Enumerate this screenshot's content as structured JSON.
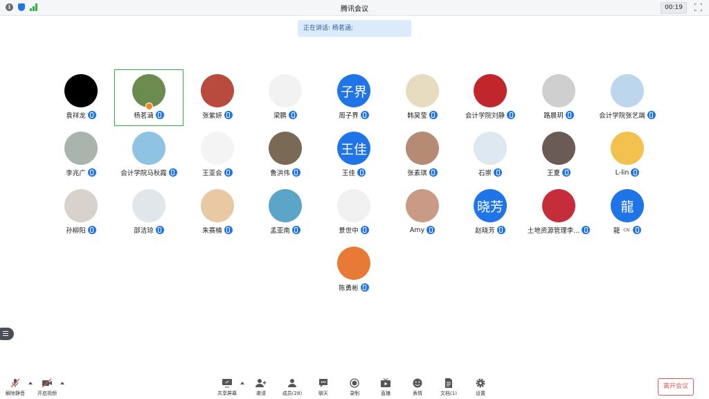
{
  "window": {
    "title": "腾讯会议",
    "timer": "00:19"
  },
  "speaking_banner": "正在讲话: 杨茗涵;",
  "participants": [
    {
      "name": "袁祥龙",
      "avatar": "black-circle-avatar",
      "color": "#000000"
    },
    {
      "name": "杨茗涵",
      "avatar": "girl-with-plants-avatar",
      "color": "#6c8b4e",
      "active": true,
      "host": true
    },
    {
      "name": "张紫妍",
      "avatar": "child-photo-avatar",
      "color": "#b94a3e"
    },
    {
      "name": "梁鹏",
      "avatar": "popeye-cartoon-avatar",
      "color": "#f2f2f2"
    },
    {
      "name": "周子界",
      "avatar_text": "子界",
      "color": "#1f75e8"
    },
    {
      "name": "韩昊莹",
      "avatar": "calligraphy-avatar",
      "color": "#e8dcc0"
    },
    {
      "name": "会计学院刘静",
      "avatar": "red-cartoon-avatar",
      "color": "#c0262b"
    },
    {
      "name": "路晨玥",
      "avatar": "cat-photo-avatar",
      "color": "#cfcfcf"
    },
    {
      "name": "会计学院张艺端",
      "avatar": "doraemon-avatar",
      "color": "#bcd6ee"
    },
    {
      "name": "李兆广",
      "avatar": "misty-mountain-avatar",
      "color": "#a9b4ad"
    },
    {
      "name": "会计学院马秋霞",
      "avatar": "sky-girl-avatar",
      "color": "#8ec3e3"
    },
    {
      "name": "王亚会",
      "avatar": "cartoon-cat-avatar",
      "color": "#f4f4f4"
    },
    {
      "name": "鲁洪伟",
      "avatar": "elder-photo-avatar",
      "color": "#7a6a55"
    },
    {
      "name": "王佳",
      "avatar_text": "王佳",
      "color": "#1f75e8"
    },
    {
      "name": "张素琪",
      "avatar": "portrait-photo-avatar",
      "color": "#b58b74"
    },
    {
      "name": "石崇",
      "avatar": "cartoon-boy-avatar",
      "color": "#dde8f0"
    },
    {
      "name": "王夏",
      "avatar": "long-hair-photo-avatar",
      "color": "#6b5b55"
    },
    {
      "name": "L-lin",
      "avatar": "teddy-bear-avatar",
      "color": "#f2c14e"
    },
    {
      "name": "孙柳阳",
      "avatar": "woman-photo-avatar",
      "color": "#d9d2cc"
    },
    {
      "name": "邵洁琼",
      "avatar": "figure-sketch-avatar",
      "color": "#e1e6ea"
    },
    {
      "name": "朱赛楠",
      "avatar": "princess-cartoon-avatar",
      "color": "#e9c9a3"
    },
    {
      "name": "孟亚南",
      "avatar": "beach-photo-avatar",
      "color": "#5aa5c8"
    },
    {
      "name": "景世中",
      "avatar": "glasses-cartoon-avatar",
      "color": "#f0f0f0"
    },
    {
      "name": "Amy",
      "avatar": "glasses-woman-avatar",
      "color": "#c99a86"
    },
    {
      "name": "赵晓芳",
      "avatar_text": "晓芳",
      "color": "#1f75e8"
    },
    {
      "name": "土地资源管理李...",
      "avatar": "sailor-moon-avatar",
      "color": "#c62d3a"
    },
    {
      "name": "龍",
      "avatar_text": "龍",
      "color": "#1f75e8",
      "tag": "CN"
    },
    {
      "name": "陈勇彬",
      "avatar": "goku-cartoon-avatar",
      "color": "#e87a36"
    }
  ],
  "toolbar": {
    "unmute": "解除静音",
    "start_video": "开启视频",
    "share_screen": "共享屏幕",
    "invite": "邀请",
    "members": "成员(28)",
    "chat": "聊天",
    "record": "录制",
    "live": "直播",
    "reactions": "表情",
    "docs": "文档(1)",
    "settings": "设置",
    "leave": "离开会议"
  },
  "colors": {
    "accent": "#1f75e8",
    "active_border": "#2fb344",
    "leave": "#e55353"
  }
}
